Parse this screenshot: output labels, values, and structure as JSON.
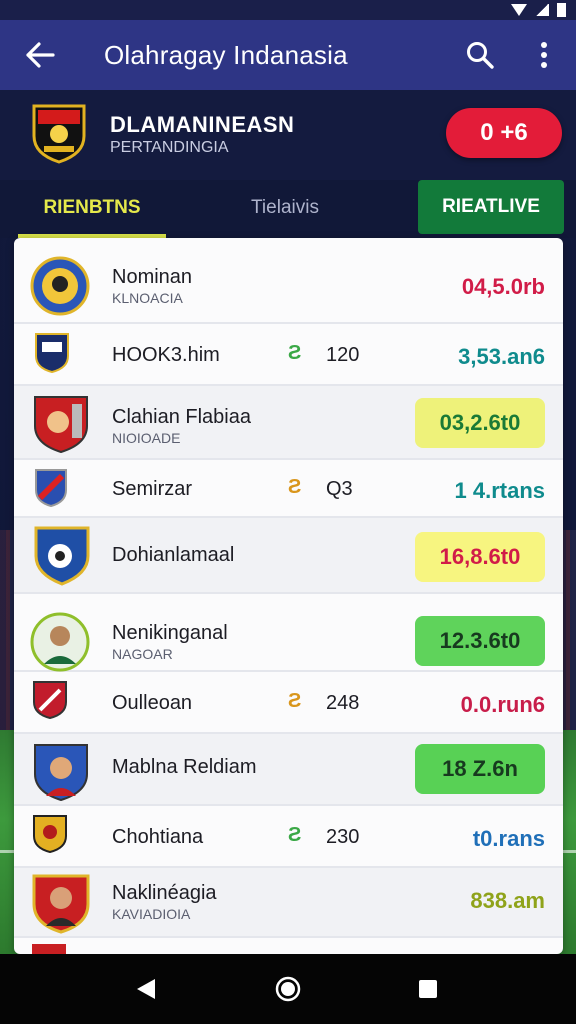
{
  "appbar": {
    "title": "Olahragay Indanasia"
  },
  "header": {
    "team_name": "DLAMANINEASN",
    "team_sub": "PERTANDINGIA",
    "score": "0 +6"
  },
  "tabs": [
    {
      "label": "RIENBTNS"
    },
    {
      "label": "Tielaivis"
    },
    {
      "label": "RIEATLIVE"
    }
  ],
  "rows": [
    {
      "name": "Nominan",
      "sub": "KLNOACIA",
      "value": "04,5.0rb",
      "value_color": "#d11c48"
    },
    {
      "name": "HOOK3.him",
      "num": "120",
      "value": "3,53.an6",
      "value_color": "#0f8b8d",
      "icon_color": "#3aa846"
    },
    {
      "name": "Clahian Flabiaa",
      "sub": "NIOIOADE",
      "value": "03,2.6t0",
      "value_color": "#1a7a36",
      "box_color": "#eef27a"
    },
    {
      "name": "Semirzar",
      "num": "Q3",
      "value": "1 4.rtans",
      "value_color": "#0f8b8d",
      "icon_color": "#d9961c"
    },
    {
      "name": "Dohianlamaal",
      "value": "16,8.6t0",
      "value_color": "#d11c48",
      "box_color": "#f7f580"
    },
    {
      "name": "Nenikinganal",
      "sub": "NAGOAR",
      "value": "12.3.6t0",
      "value_color": "#173a1f",
      "box_color": "#5fd35b"
    },
    {
      "name": "Oulleoan",
      "num": "248",
      "value": "0.0.run6",
      "value_color": "#c81d4a",
      "icon_color": "#d9961c"
    },
    {
      "name": "Mablna Reldiam",
      "value": "18 Z.6n",
      "value_color": "#173a1f",
      "box_color": "#58d155"
    },
    {
      "name": "Chohtiana",
      "num": "230",
      "value": "t0.rans",
      "value_color": "#1f6fb8",
      "icon_color": "#3aa846"
    },
    {
      "name": "Naklinéagia",
      "sub": "KAVIADIOIA",
      "value": "838.am",
      "value_color": "#8fa31a"
    }
  ],
  "icons": {
    "back": "arrow-left-icon",
    "search": "search-icon",
    "more": "more-vert-icon",
    "stat": "stat-icon"
  },
  "colors": {
    "appbar": "#2e3585",
    "score_pill": "#e31c39",
    "tab_active": "#d8e14a",
    "tab_live": "#127a3a"
  }
}
